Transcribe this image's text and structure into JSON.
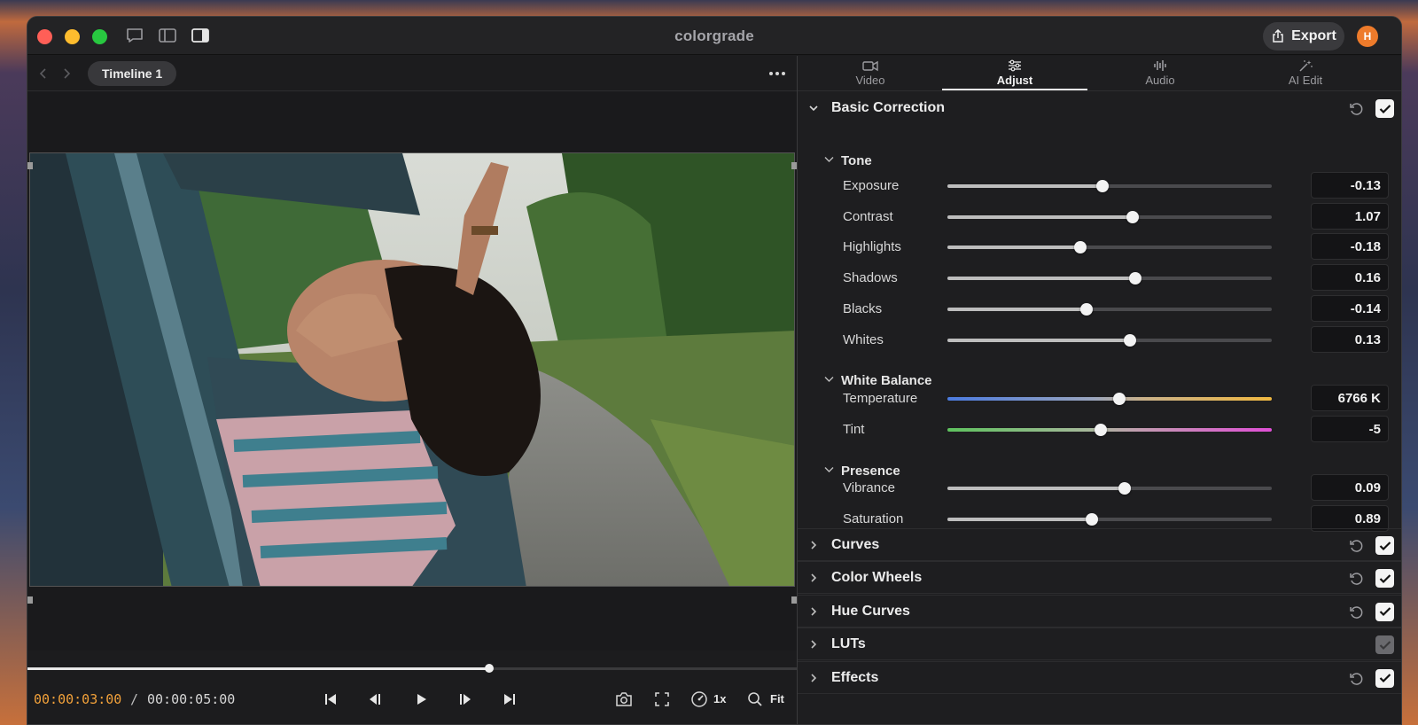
{
  "app": {
    "title": "colorgrade",
    "export_label": "Export",
    "avatar_initial": "H"
  },
  "viewer": {
    "timeline_tab": "Timeline 1",
    "timecode_current": "00:00:03:00",
    "timecode_separator": "/",
    "timecode_total": "00:00:05:00",
    "playhead_fraction": 0.6,
    "speed_label": "1x",
    "zoom_label": "Fit"
  },
  "tabs": [
    {
      "label": "Video",
      "icon": "video-camera-icon"
    },
    {
      "label": "Adjust",
      "icon": "sliders-icon",
      "active": true
    },
    {
      "label": "Audio",
      "icon": "waveform-icon"
    },
    {
      "label": "AI Edit",
      "icon": "magic-wand-icon"
    }
  ],
  "basic_correction": {
    "title": "Basic Correction",
    "enabled": true,
    "tone": {
      "title": "Tone",
      "rows": [
        {
          "label": "Exposure",
          "value": "-0.13",
          "position": 0.477
        },
        {
          "label": "Contrast",
          "value": "1.07",
          "position": 0.571
        },
        {
          "label": "Highlights",
          "value": "-0.18",
          "position": 0.409
        },
        {
          "label": "Shadows",
          "value": "0.16",
          "position": 0.58
        },
        {
          "label": "Blacks",
          "value": "-0.14",
          "position": 0.429
        },
        {
          "label": "Whites",
          "value": "0.13",
          "position": 0.564
        }
      ]
    },
    "white_balance": {
      "title": "White Balance",
      "rows": [
        {
          "label": "Temperature",
          "value": "6766 K",
          "position": 0.53
        },
        {
          "label": "Tint",
          "value": "-5",
          "position": 0.474
        }
      ]
    },
    "presence": {
      "title": "Presence",
      "rows": [
        {
          "label": "Vibrance",
          "value": "0.09",
          "position": 0.547
        },
        {
          "label": "Saturation",
          "value": "0.89",
          "position": 0.445
        }
      ]
    }
  },
  "sections": [
    {
      "title": "Curves",
      "enabled": true
    },
    {
      "title": "Color Wheels",
      "enabled": true
    },
    {
      "title": "Hue Curves",
      "enabled": true
    },
    {
      "title": "LUTs",
      "enabled": false
    },
    {
      "title": "Effects",
      "enabled": true
    }
  ],
  "colors": {
    "accent_timecode": "#f2a13a",
    "avatar": "#ee7b2b",
    "close": "#ff5f57",
    "minimize": "#febc2e",
    "zoom": "#28c840"
  }
}
